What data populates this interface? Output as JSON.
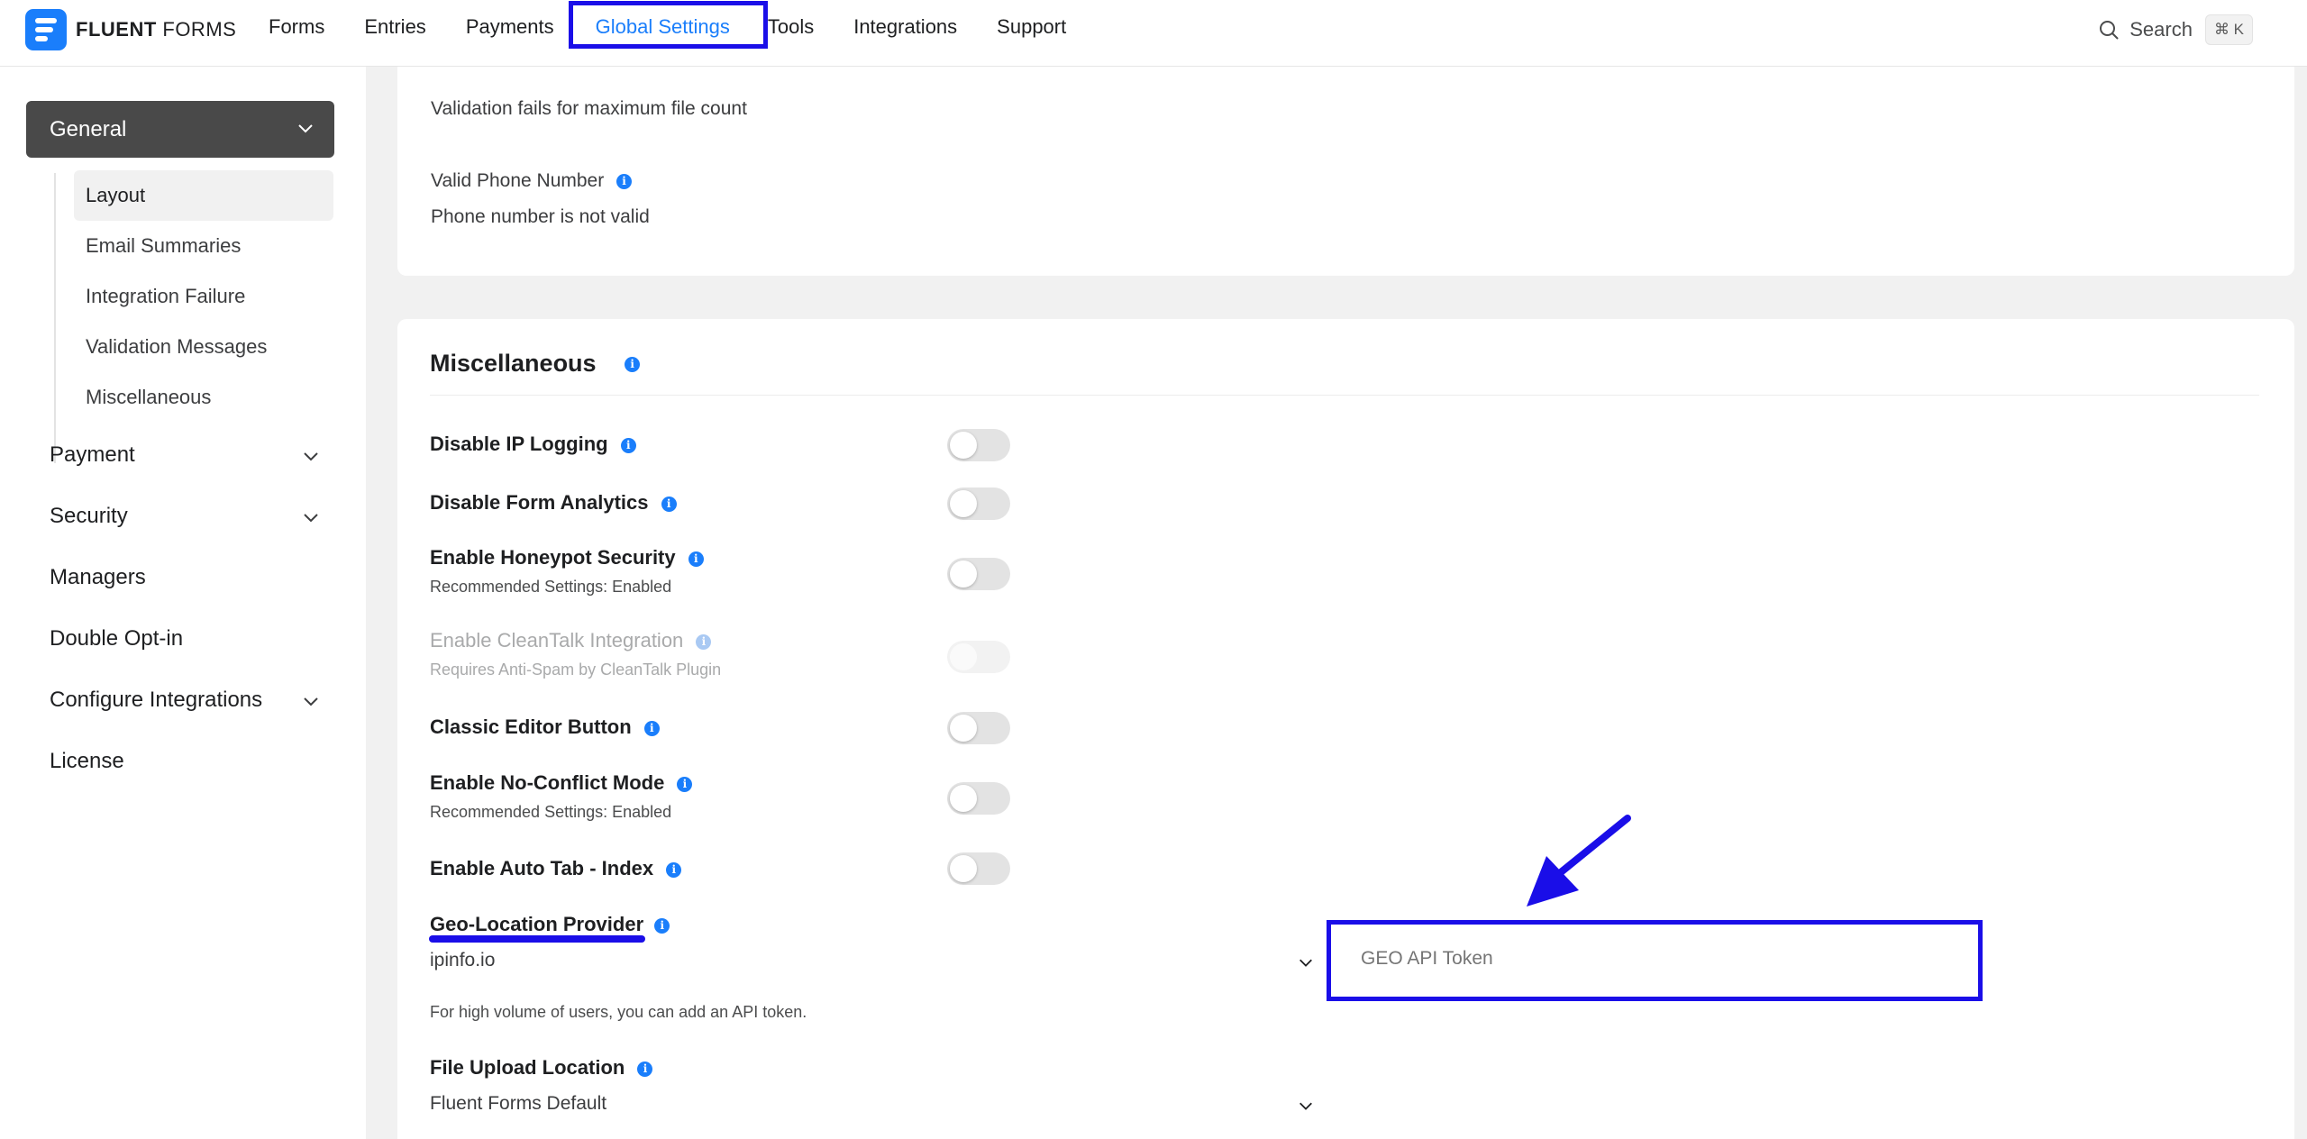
{
  "brand": {
    "name_bold": "FLUENT",
    "name_rest": " FORMS"
  },
  "nav": {
    "items": [
      "Forms",
      "Entries",
      "Payments",
      "Global Settings",
      "Tools",
      "Integrations",
      "Support"
    ],
    "active": "Global Settings"
  },
  "search": {
    "label": "Search",
    "shortcut": "⌘ K"
  },
  "sidebar": {
    "general": "General",
    "sub_items": [
      "Layout",
      "Email Summaries",
      "Integration Failure",
      "Validation Messages",
      "Miscellaneous"
    ],
    "active_sub": "Layout",
    "items": [
      "Payment",
      "Security",
      "Managers",
      "Double Opt-in",
      "Configure Integrations",
      "License"
    ]
  },
  "validation": {
    "max_file_count_text": "Validation fails for maximum file count",
    "phone_label": "Valid Phone Number",
    "phone_text": "Phone number is not valid"
  },
  "misc": {
    "title": "Miscellaneous",
    "options": [
      {
        "label": "Disable IP Logging",
        "sub": "",
        "enabled": false,
        "disabled": false
      },
      {
        "label": "Disable Form Analytics",
        "sub": "",
        "enabled": false,
        "disabled": false
      },
      {
        "label": "Enable Honeypot Security",
        "sub": "Recommended Settings: Enabled",
        "enabled": false,
        "disabled": false
      },
      {
        "label": "Enable CleanTalk Integration",
        "sub": "Requires Anti-Spam by CleanTalk Plugin",
        "enabled": false,
        "disabled": true
      },
      {
        "label": "Classic Editor Button",
        "sub": "",
        "enabled": false,
        "disabled": false
      },
      {
        "label": "Enable No-Conflict Mode",
        "sub": "Recommended Settings: Enabled",
        "enabled": false,
        "disabled": false
      },
      {
        "label": "Enable Auto Tab - Index",
        "sub": "",
        "enabled": false,
        "disabled": false
      }
    ],
    "geo_label": "Geo-Location Provider",
    "geo_value": "ipinfo.io",
    "geo_token_placeholder": "GEO API Token",
    "geo_help": "For high volume of users, you can add an API token.",
    "upload_label": "File Upload Location",
    "upload_value": "Fluent Forms Default"
  },
  "colors": {
    "accent": "#1a7efb",
    "annotation": "#1a0ee8",
    "sidebar_active": "#494949"
  }
}
